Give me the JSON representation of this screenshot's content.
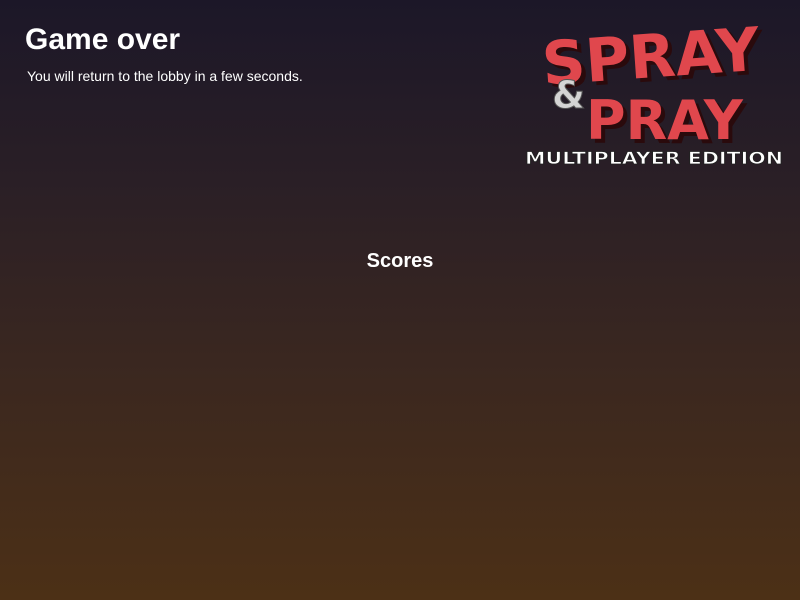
{
  "header": {
    "title": "Game over",
    "subtitle": "You will return to the lobby in a few seconds."
  },
  "logo": {
    "line1": "SPRAY",
    "ampersand": "&",
    "line2": "PRAY",
    "edition": "MULTIPLAYER EDITION"
  },
  "scores": {
    "heading": "Scores"
  },
  "colors": {
    "logo_red": "#e0474d",
    "logo_shadow": "#2a0a0c",
    "ampersand": "#d4d4d4"
  }
}
